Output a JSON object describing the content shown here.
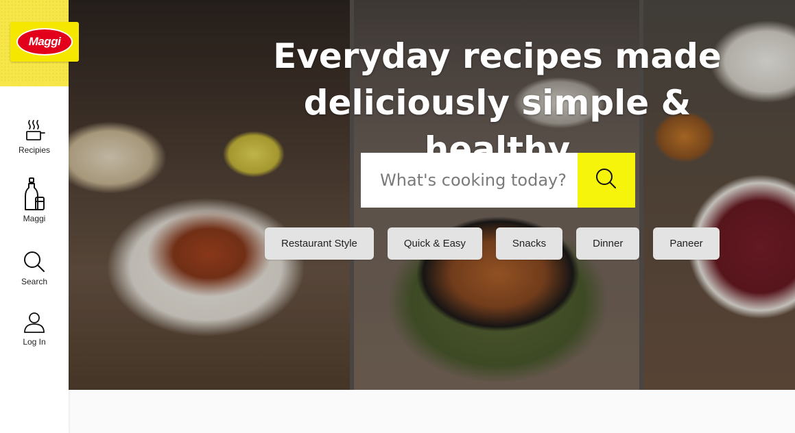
{
  "brand": {
    "logo_text": "Maggi",
    "primary_yellow": "#f5e700",
    "logo_red": "#e2001a"
  },
  "sidebar": {
    "items": [
      {
        "label": "Recipies",
        "icon": "cooking-pot-icon"
      },
      {
        "label": "Maggi",
        "icon": "maggi-products-icon"
      },
      {
        "label": "Search",
        "icon": "search-icon"
      },
      {
        "label": "Log In",
        "icon": "user-icon"
      }
    ]
  },
  "hero": {
    "headline_line1": "Everyday recipes made",
    "headline_line2": "deliciously simple & healthy",
    "search": {
      "placeholder": "What's cooking today?",
      "value": "",
      "button_icon": "search-icon",
      "button_color": "#f5f40a"
    },
    "chips": [
      "Restaurant Style",
      "Quick & Easy",
      "Snacks",
      "Dinner",
      "Paneer"
    ]
  }
}
